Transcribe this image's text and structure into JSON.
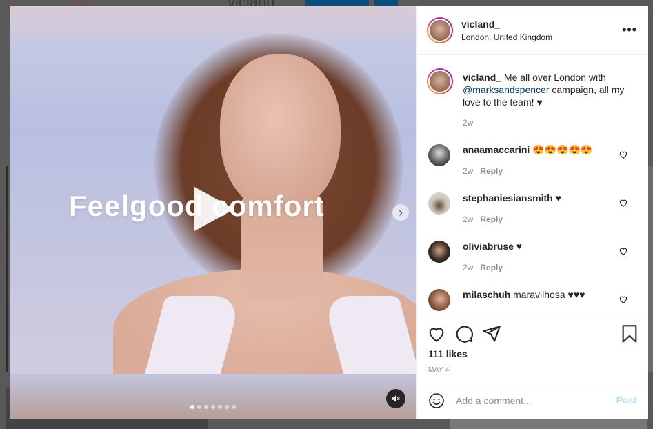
{
  "background": {
    "username": "vicland"
  },
  "media": {
    "overlay_text": "Feelgood comfort",
    "play_icon": "play-icon",
    "next_icon": "chevron-right-icon",
    "next_glyph": "›",
    "mute_icon": "muted-speaker-icon",
    "carousel_dots": 7,
    "active_dot": 0
  },
  "header": {
    "username": "vicland_",
    "location": "London, United Kingdom",
    "more_glyph": "•••"
  },
  "caption": {
    "username": "vicland_",
    "text_before": " Me all over London with ",
    "mention": "@marksandspencer",
    "text_after": " campaign, all my love to the team! ♥",
    "time": "2w"
  },
  "comments": [
    {
      "username": "anaamaccarini",
      "text": " 😍😍😍😍😍",
      "time": "2w",
      "reply": "Reply",
      "avatar_color": "#3a3a3a"
    },
    {
      "username": "stephaniesiansmith",
      "text": " ♥",
      "time": "2w",
      "reply": "Reply",
      "avatar_color": "#a89f95"
    },
    {
      "username": "oliviabruse",
      "text": " ♥",
      "time": "2w",
      "reply": "Reply",
      "avatar_color": "#4a3b2c"
    },
    {
      "username": "milaschuh",
      "text": " maravilhosa ♥♥♥",
      "time": "",
      "reply": "",
      "avatar_color": "#8a5a3f"
    }
  ],
  "actions": {
    "like_icon": "heart-icon",
    "comment_icon": "comment-icon",
    "share_icon": "paper-plane-icon",
    "save_icon": "bookmark-icon",
    "likes": "111 likes",
    "date": "MAY 4"
  },
  "add_comment": {
    "placeholder": "Add a comment...",
    "post_label": "Post"
  },
  "colors": {
    "accent": "#0095f6",
    "post_disabled": "#b2dffc",
    "mention": "#00376b"
  }
}
